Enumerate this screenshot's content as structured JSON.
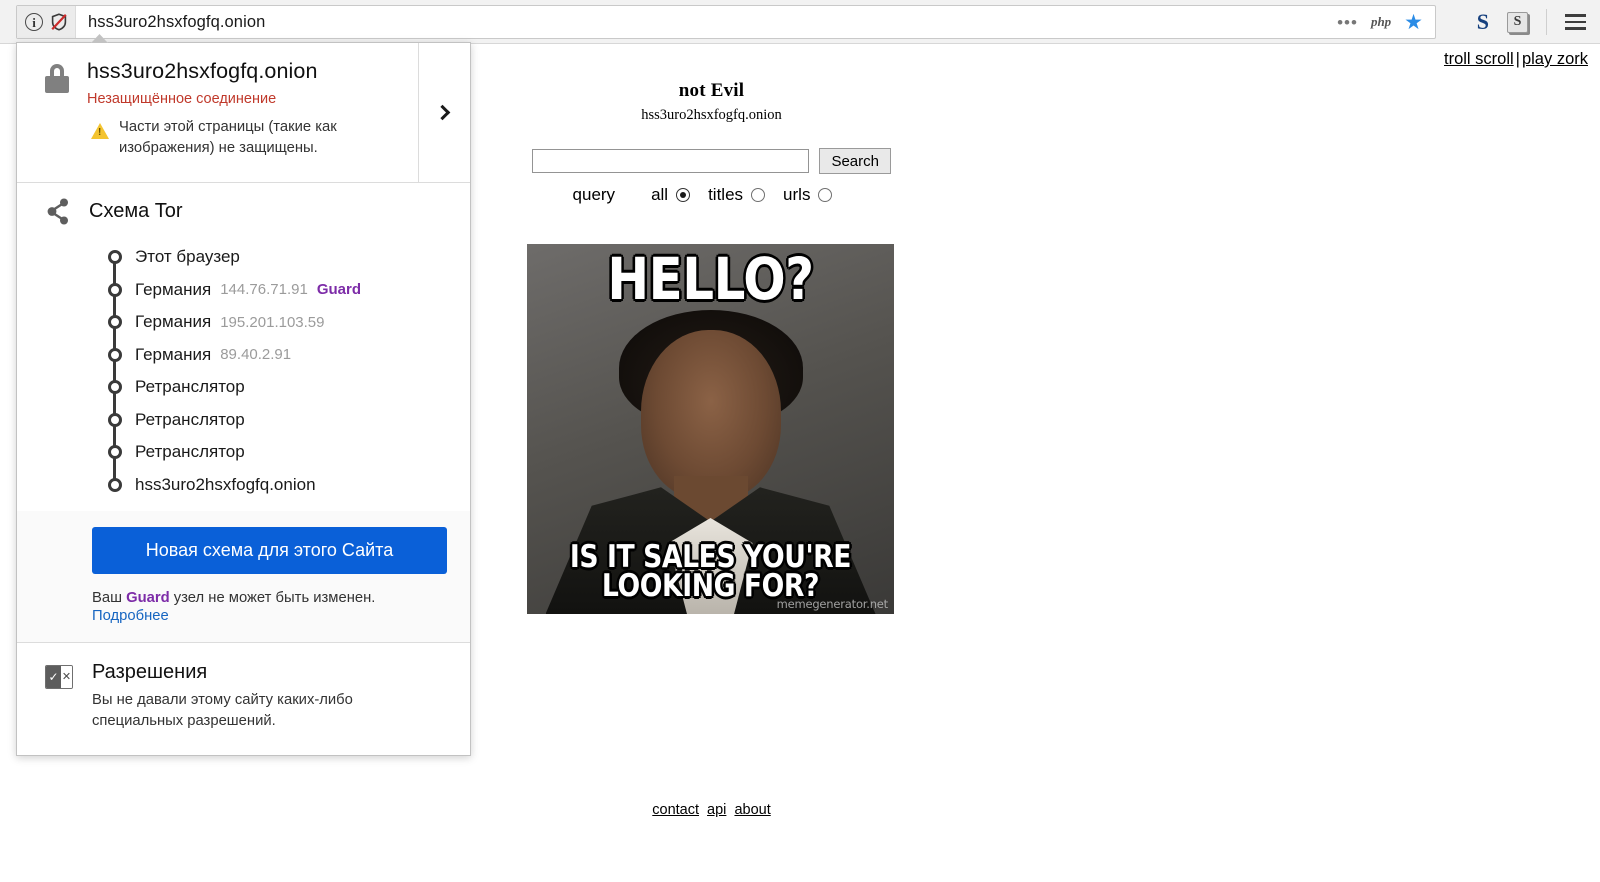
{
  "browser": {
    "url": "hss3uro2hsxfogfq.onion",
    "identity_info_icon": "info-circle-icon",
    "tor_shield_icon": "broken-shield-icon",
    "toolbar_icons": [
      "more-dots-icon",
      "php-icon",
      "bookmark-star-icon",
      "extension-s-blue-icon",
      "extension-s-gray-icon",
      "hamburger-menu-icon"
    ],
    "php_label": "php",
    "ext_blue_label": "S",
    "ext_gray_label": "S"
  },
  "popup": {
    "security": {
      "host": "hss3uro2hsxfogfq.onion",
      "status": "Незащищённое соединение",
      "warning": "Части этой страницы (такие как изображения) не защищены.",
      "lock_icon": "padlock-icon",
      "warning_icon": "warning-triangle-icon",
      "expand_icon": "chevron-right-icon"
    },
    "tor": {
      "title": "Схема Tor",
      "icon": "tor-circuit-share-icon",
      "nodes": [
        {
          "label": "Этот браузер",
          "ip": "",
          "role": ""
        },
        {
          "label": "Германия",
          "ip": "144.76.71.91",
          "role": "Guard"
        },
        {
          "label": "Германия",
          "ip": "195.201.103.59",
          "role": ""
        },
        {
          "label": "Германия",
          "ip": "89.40.2.91",
          "role": ""
        },
        {
          "label": "Ретранслятор",
          "ip": "",
          "role": ""
        },
        {
          "label": "Ретранслятор",
          "ip": "",
          "role": ""
        },
        {
          "label": "Ретранслятор",
          "ip": "",
          "role": ""
        },
        {
          "label": "hss3uro2hsxfogfq.onion",
          "ip": "",
          "role": ""
        }
      ]
    },
    "new_circuit": {
      "button_label": "Новая схема для этого Сайта",
      "note_prefix": "Ваш ",
      "note_guard": "Guard",
      "note_suffix": " узел не может быть изменен.",
      "learn_more": "Подробнее",
      "button_color": "#0a60d8",
      "guard_color": "#7d2ca8"
    },
    "permissions": {
      "title": "Разрешения",
      "description": "Вы не давали этому сайту каких-либо специальных разрешений.",
      "icon": "permissions-check-x-icon",
      "check_glyph": "✓",
      "x_glyph": "✕"
    }
  },
  "page": {
    "top_links": {
      "troll": "troll scroll",
      "separator": "|",
      "zork": "play zork"
    },
    "site_title": "not Evil",
    "site_host": "hss3uro2hsxfogfq.onion",
    "search": {
      "value": "",
      "placeholder": "",
      "button_label": "Search",
      "query_label": "query",
      "options": [
        {
          "label": "all",
          "selected": true
        },
        {
          "label": "titles",
          "selected": false
        },
        {
          "label": "urls",
          "selected": false
        }
      ]
    },
    "meme": {
      "top_text": "HELLO?",
      "bottom_text": "IS IT SALES YOU'RE LOOKING FOR?",
      "watermark": "memegenerator.net"
    },
    "footer_links": [
      "contact",
      "api",
      "about"
    ]
  }
}
